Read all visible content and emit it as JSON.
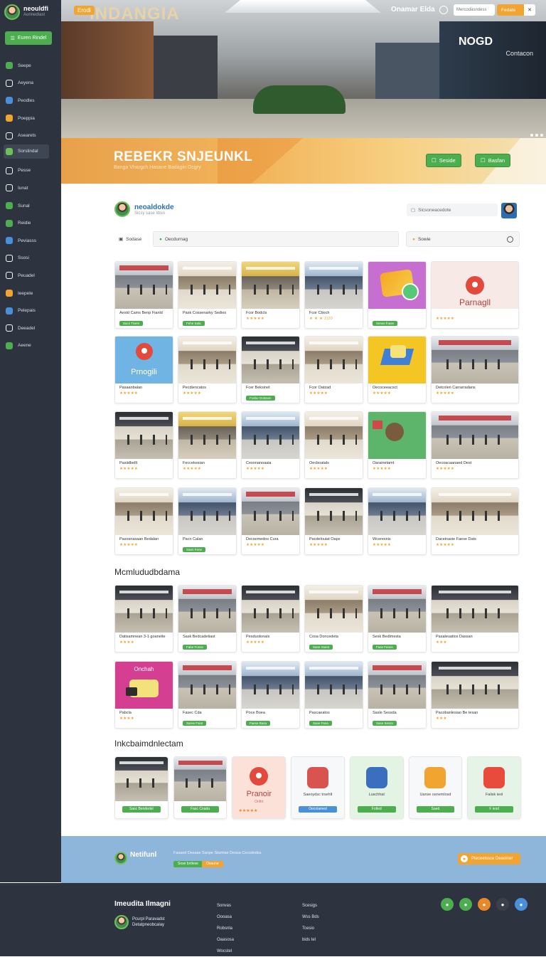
{
  "brand": {
    "title": "neouldfi",
    "subtitle": "Aorinedlast"
  },
  "sidebar": {
    "button_label": "Euren Rindel",
    "items": [
      {
        "label": "Seepe",
        "icon": "grid-icon",
        "color": "#4cae4f"
      },
      {
        "label": "Aeyena",
        "icon": "users-icon",
        "color": "#ffffff"
      },
      {
        "label": "Peodles",
        "icon": "chat-icon",
        "color": "#4a90d9"
      },
      {
        "label": "Poeppia",
        "icon": "store-icon",
        "color": "#f2a431"
      },
      {
        "label": "Asearets",
        "icon": "compass-icon",
        "color": "#ffffff"
      },
      {
        "label": "Sorslindal",
        "icon": "profile-icon",
        "color": "#6fc05a"
      },
      {
        "label": "Pesse",
        "icon": "bars-icon",
        "color": "#ffffff"
      },
      {
        "label": "Iunat",
        "icon": "cloud-icon",
        "color": "#ffffff"
      },
      {
        "label": "Sunal",
        "icon": "book-icon",
        "color": "#4cae4f"
      },
      {
        "label": "Reidie",
        "icon": "tag-icon",
        "color": "#4cae4f"
      },
      {
        "label": "Peviasss",
        "icon": "globe-icon",
        "color": "#4a90d9"
      },
      {
        "label": "Ssosi",
        "icon": "refresh-icon",
        "color": "#ffffff"
      },
      {
        "label": "Peuadel",
        "icon": "flag-icon",
        "color": "#ffffff"
      },
      {
        "label": "Ieepele",
        "icon": "star-icon",
        "color": "#f2a431"
      },
      {
        "label": "Pelepais",
        "icon": "triangle-icon",
        "color": "#4a90d9"
      },
      {
        "label": "Deeadel",
        "icon": "settings-icon",
        "color": "#ffffff"
      },
      {
        "label": "Aeene",
        "icon": "check-icon",
        "color": "#4cae4f"
      }
    ]
  },
  "hero": {
    "badge": "Erodi",
    "sign_left": "INDANGIA",
    "sign_right": "NOGD",
    "sign_right_small": "Contacon",
    "top_title": "Onamar Elda",
    "search_placeholder": "Mercodasndess",
    "cta_label": "Fedate",
    "cta_icon_label": "✕"
  },
  "banner": {
    "title": "REBEKR SNJEUNKL",
    "subtitle": "Banga Vhargch Hasane Badagin Ocgry",
    "btn1": "Seside",
    "btn2": "Basfan"
  },
  "profile": {
    "name": "neoaldokde",
    "handle": "Sicsy sase Idisn"
  },
  "search": {
    "placeholder": "Sicsoneacedote"
  },
  "filters": {
    "f1": "Sodase",
    "f2": "Oecdurnag",
    "f3": "Sowie"
  },
  "grid1": [
    {
      "title": "Aestd Cams Benp Fianld",
      "meta": "Sacs Tivem",
      "kind": "tag",
      "img": "mall red"
    },
    {
      "title": "Pask Cossenarky Sedies",
      "meta": "Fehe Sala",
      "kind": "tag",
      "img": "mall warm"
    },
    {
      "title": "Fcor Bodcts",
      "meta": "★★★★★",
      "kind": "stars",
      "img": "mall gold"
    },
    {
      "title": "Fcor Cboch",
      "meta": "★ ★ ★ 2|20",
      "kind": "stars",
      "img": "mall blue"
    },
    {
      "title": "",
      "meta": "Sense fnase",
      "kind": "tag",
      "img": "promo-purple"
    },
    {
      "title": "",
      "meta": "★★★★★",
      "kind": "stars",
      "img": "promo-pink",
      "name": "Parnagll"
    }
  ],
  "grid2": [
    {
      "title": "Pasaanbalan",
      "meta": "★★★★★",
      "kind": "stars",
      "img": "promo-sky",
      "name": "Prnogili"
    },
    {
      "title": "Pecdiencatos",
      "meta": "★★★★★",
      "kind": "stars",
      "img": "mall warm"
    },
    {
      "title": "Fcer Beksinet",
      "meta": "Fosbo Gotssen",
      "kind": "tag",
      "img": "mall dark"
    },
    {
      "title": "Fcor Oatzad",
      "meta": "★★★★★",
      "kind": "stars",
      "img": "mall warm"
    },
    {
      "title": "Oecoceeacsct",
      "meta": "★★★★★",
      "kind": "stars",
      "img": "promo-yellow"
    },
    {
      "title": "Detcolen Carrarradans",
      "meta": "★★★★★",
      "kind": "stars",
      "img": "mall red"
    }
  ],
  "grid3": [
    {
      "title": "Pasiidbellt",
      "meta": "★★★★★",
      "kind": "stars",
      "img": "mall dark"
    },
    {
      "title": "Feccekesian",
      "meta": "★★★★★",
      "kind": "stars",
      "img": "mall gold"
    },
    {
      "title": "Cesonanoaaia",
      "meta": "★★★★★",
      "kind": "stars",
      "img": "mall blue"
    },
    {
      "title": "Oecboatals",
      "meta": "★★★★★",
      "kind": "stars",
      "img": "mall warm"
    },
    {
      "title": "Oarainetamt",
      "meta": "★★★★★",
      "kind": "stars",
      "img": "promo-green"
    },
    {
      "title": "Oecoacaanaed Dest",
      "meta": "★★★★★",
      "kind": "stars",
      "img": "mall red"
    }
  ],
  "grid4": [
    {
      "title": "Pasosnasaan Bedalan",
      "meta": "★★★★★",
      "kind": "stars",
      "img": "mall warm"
    },
    {
      "title": "Pacn Calan",
      "meta": "Saen Fene",
      "kind": "tag",
      "img": "mall blue"
    },
    {
      "title": "Decsemedos Cura",
      "meta": "★★★★★",
      "kind": "stars",
      "img": "mall red"
    },
    {
      "title": "Pacdelouiat Oaps",
      "meta": "★★★★★",
      "kind": "stars",
      "img": "mall dark"
    },
    {
      "title": "Wceresnis",
      "meta": "★★★★★",
      "kind": "stars",
      "img": "mall blue"
    },
    {
      "title": "Daceinasie Faese Dats",
      "meta": "★★★★★",
      "kind": "stars",
      "img": "mall warm"
    }
  ],
  "section2_title": "Mcmlududbdama",
  "grid5": [
    {
      "title": "Datisamnean 3-1 goaneite",
      "meta": "★★★★",
      "kind": "stars",
      "img": "mall dark"
    },
    {
      "title": "Sask Bedcadetiast",
      "meta": "Fabe Fonss",
      "kind": "tag",
      "img": "mall red"
    },
    {
      "title": "Pesduotonals",
      "meta": "★★★★★",
      "kind": "stars",
      "img": "mall dark"
    },
    {
      "title": "Cosa Doncedeta",
      "meta": "Sane Ssent",
      "kind": "tag",
      "img": "mall warm"
    },
    {
      "title": "Sesk Bedlmesta",
      "meta": "Fase Fenes",
      "kind": "tag",
      "img": "mall red"
    },
    {
      "title": "Pasaleuatios Dassan",
      "meta": "★★★",
      "kind": "stars",
      "img": "mall dark"
    }
  ],
  "grid6": [
    {
      "title": "Pabcla",
      "meta": "★★★★",
      "kind": "stars",
      "img": "promo-magenta",
      "name": "Onchah"
    },
    {
      "title": "Fasec Cda",
      "meta": "Saree Fsiat",
      "kind": "tag",
      "img": "mall red"
    },
    {
      "title": "Poce Boea",
      "meta": "Faese Basa",
      "kind": "tag",
      "img": "mall blue"
    },
    {
      "title": "Pascaeatos",
      "meta": "Sase Fana",
      "kind": "tag",
      "img": "mall blue"
    },
    {
      "title": "Sasle Sessda",
      "meta": "Sase Sessn",
      "kind": "tag",
      "img": "mall red"
    },
    {
      "title": "Pacobanlesiao Be tesan",
      "meta": "★★★",
      "kind": "stars",
      "img": "mall dark"
    }
  ],
  "section3_title": "Inkcbaimdnlectam",
  "apps": [
    {
      "caption": "",
      "label": "Sasc Bendedel",
      "style": "green",
      "img": "mall dark"
    },
    {
      "caption": "",
      "label": "Fasc Coada",
      "style": "green",
      "img": "mall red"
    },
    {
      "caption": "",
      "label": "★★★★★",
      "style": "stars",
      "img": "promo-peach",
      "name": "Pranoir",
      "sub": "Onfirt"
    },
    {
      "caption": "Saeoydsc trsehlt",
      "label": "Oecolamed",
      "style": "blue",
      "img": "app1",
      "icon_color": "#d9534f"
    },
    {
      "caption": "Luschhat",
      "label": "Fotled",
      "style": "green",
      "img": "app2",
      "icon_color": "#3a6fc0"
    },
    {
      "caption": "Uanse osnemlosd",
      "label": "Saed",
      "style": "green",
      "img": "app3",
      "icon_color": "#f2a431"
    },
    {
      "caption": "Falisk ieol",
      "label": "F iesd",
      "style": "green",
      "img": "app4",
      "icon_color": "#e84b3c"
    }
  ],
  "foot_band": {
    "name": "Netifunl",
    "links": "Fasaed Dessae Sanpe    Stamiae    Dessa Cecsdodss",
    "tag1": "Sose bntlese",
    "tag2": "Osaune",
    "cta": "Pteceelssce Deaoiner",
    "cta_icon_label": "●"
  },
  "footer": {
    "title": "Imeudita Ilmagni",
    "user_line1": "Pcurpl Paravadst",
    "user_line2": "Detatpneobcalay",
    "col1": [
      "Sonvas",
      "Oooasa",
      "Robsnla",
      "Oaasosa",
      "Wocstel"
    ],
    "col2": [
      "Scesigs",
      "Wss Bds",
      "Tcesio",
      "bids tel"
    ],
    "social_colors": [
      "#4cae4f",
      "#4cae4f",
      "#e8882b",
      "#3b3f4a",
      "#4a90d9"
    ],
    "social_icons": [
      "leaf-icon",
      "chat-icon",
      "bag-icon",
      "qr-icon",
      "map-pin-icon"
    ]
  }
}
